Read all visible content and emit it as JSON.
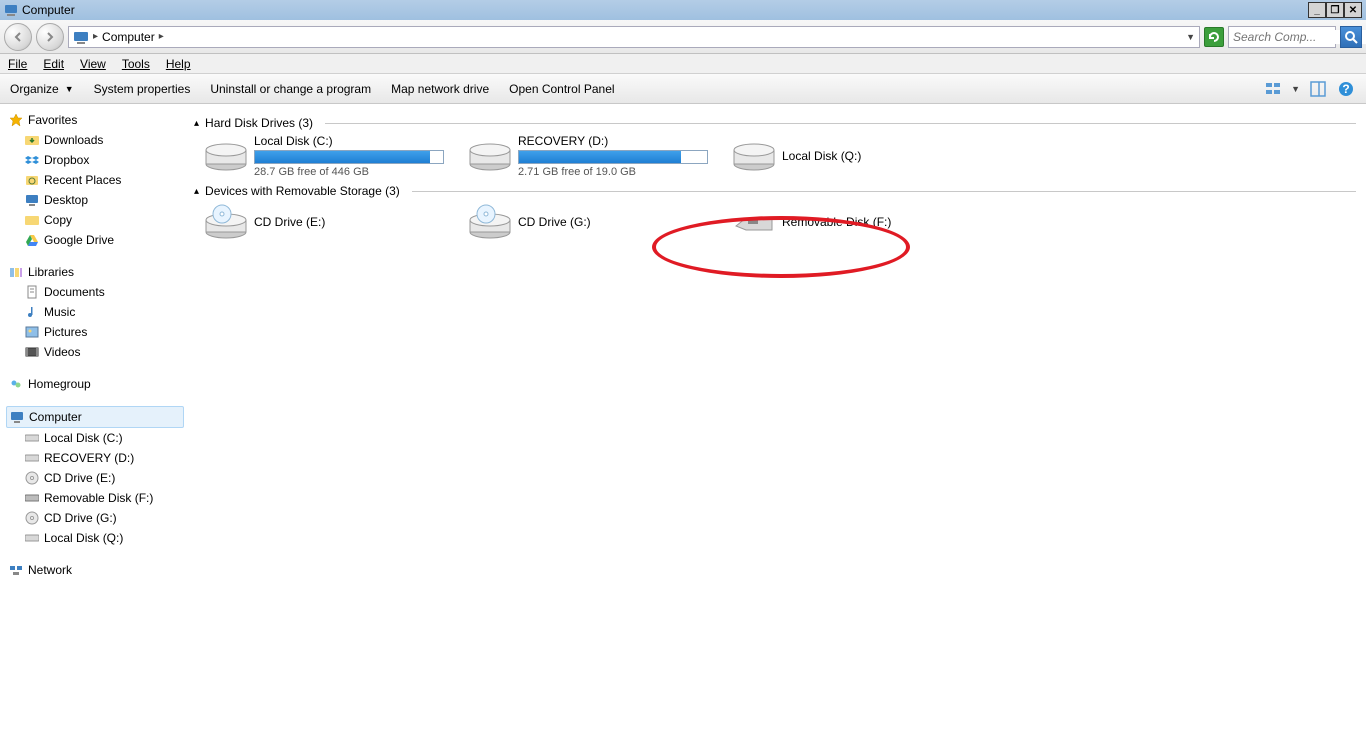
{
  "window": {
    "title": "Computer"
  },
  "address": {
    "location": "Computer"
  },
  "search": {
    "placeholder": "Search Comp..."
  },
  "menubar": [
    "File",
    "Edit",
    "View",
    "Tools",
    "Help"
  ],
  "cmdbar": {
    "organize": "Organize",
    "items": [
      "System properties",
      "Uninstall or change a program",
      "Map network drive",
      "Open Control Panel"
    ]
  },
  "sidebar": {
    "favorites": {
      "label": "Favorites",
      "items": [
        "Downloads",
        "Dropbox",
        "Recent Places",
        "Desktop",
        "Copy",
        "Google Drive"
      ]
    },
    "libraries": {
      "label": "Libraries",
      "items": [
        "Documents",
        "Music",
        "Pictures",
        "Videos"
      ]
    },
    "homegroup": {
      "label": "Homegroup"
    },
    "computer": {
      "label": "Computer",
      "items": [
        "Local Disk (C:)",
        "RECOVERY (D:)",
        "CD Drive (E:)",
        "Removable Disk (F:)",
        "CD Drive (G:)",
        "Local Disk (Q:)"
      ]
    },
    "network": {
      "label": "Network"
    }
  },
  "sections": {
    "hdd": {
      "label": "Hard Disk Drives (3)"
    },
    "rem": {
      "label": "Devices with Removable Storage (3)"
    }
  },
  "drives": {
    "hdd": [
      {
        "name": "Local Disk (C:)",
        "free": "28.7 GB free of 446 GB",
        "fill_pct": 93
      },
      {
        "name": "RECOVERY (D:)",
        "free": "2.71 GB free of 19.0 GB",
        "fill_pct": 86
      },
      {
        "name": "Local Disk (Q:)",
        "free": "",
        "fill_pct": null
      }
    ],
    "rem": [
      {
        "name": "CD Drive (E:)"
      },
      {
        "name": "CD Drive (G:)"
      },
      {
        "name": "Removable Disk (F:)"
      }
    ]
  }
}
